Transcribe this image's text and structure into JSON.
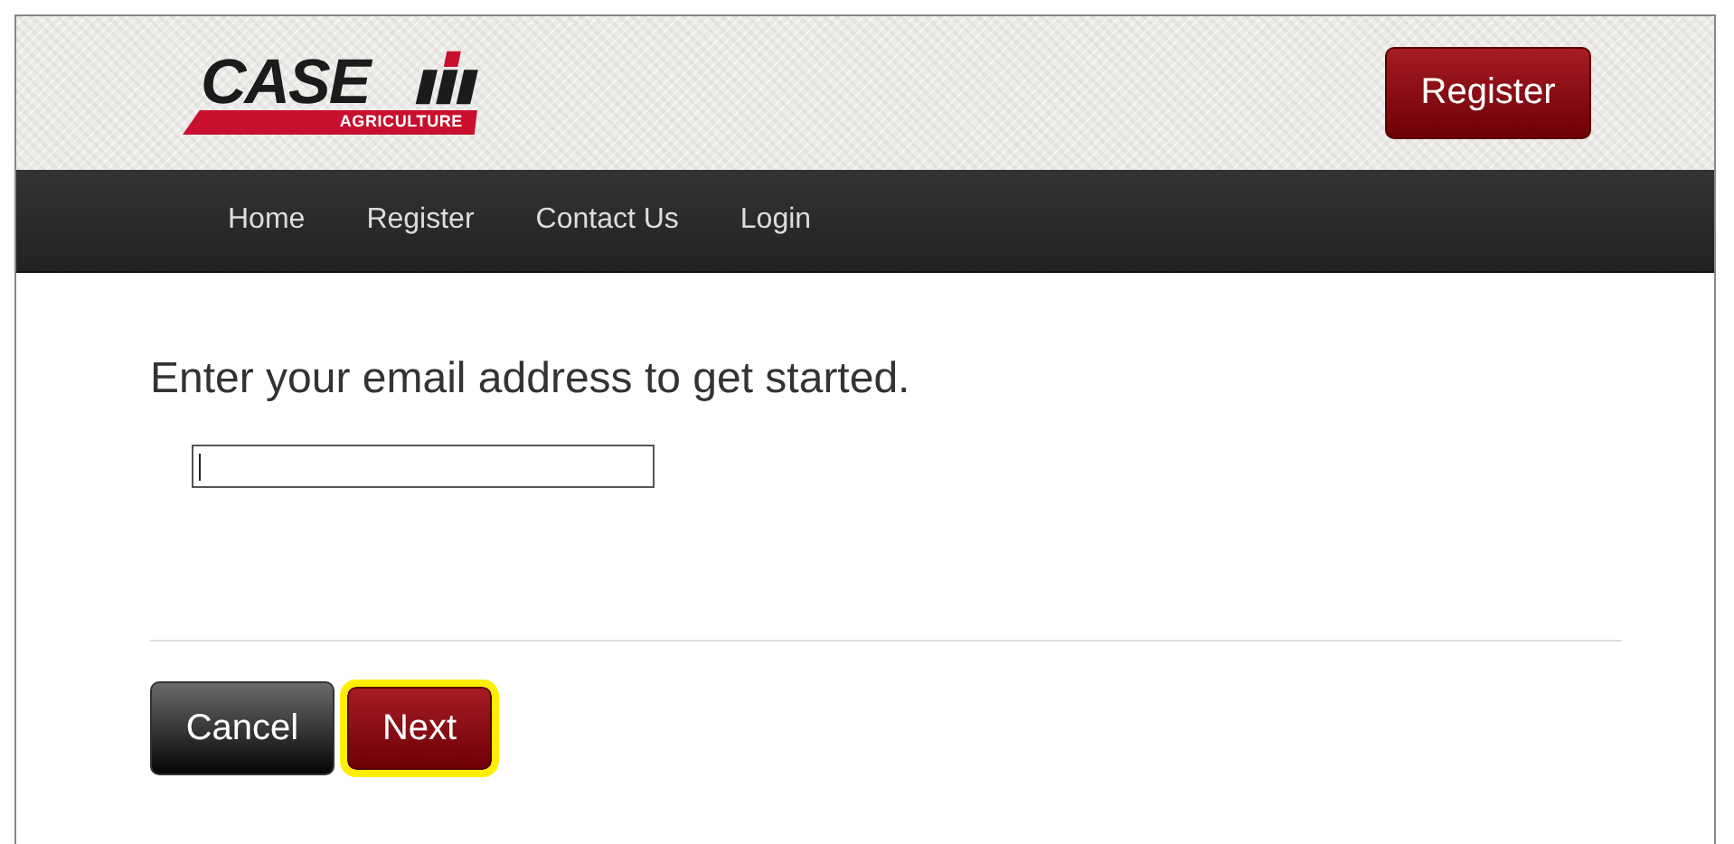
{
  "header": {
    "logo": {
      "wordmark": "CASE",
      "tagline": "AGRICULTURE"
    },
    "register_button": "Register"
  },
  "nav": {
    "items": [
      {
        "label": "Home"
      },
      {
        "label": "Register"
      },
      {
        "label": "Contact Us"
      },
      {
        "label": "Login"
      }
    ]
  },
  "form": {
    "heading": "Enter your email address to get started.",
    "email_field": {
      "focused": true
    }
  },
  "buttons": [
    {
      "label": "Cancel",
      "kind": "secondary",
      "highlighted": false
    },
    {
      "label": "Next",
      "kind": "primary",
      "highlighted": true
    }
  ]
}
